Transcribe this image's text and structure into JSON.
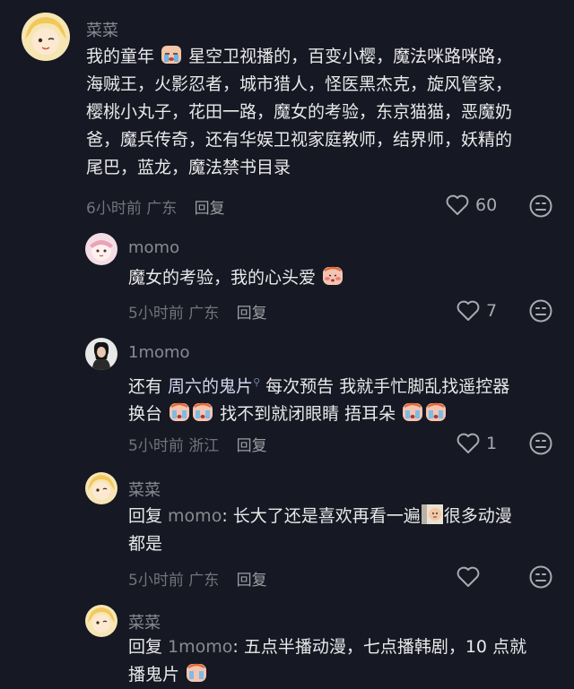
{
  "comments": [
    {
      "username": "菜菜",
      "lines": [
        [
          "我的童年",
          "",
          "星空卫视播的，百变小樱，魔法咪路咪路，"
        ],
        [
          "海贼王，火影忍者，城市猎人，怪医黑杰克，旋风管家，"
        ],
        [
          "樱桃小丸子，花田一路，魔女的考验，东京猫猫，恶魔奶"
        ],
        [
          "爸，魔兵传奇，还有华娱卫视家庭教师，结界师，妖精的"
        ],
        [
          "尾巴，蓝龙，魔法禁书目录"
        ]
      ],
      "time": "6小时前",
      "location": "广东",
      "reply": "回复",
      "likes": "60"
    },
    {
      "username": "momo",
      "lines": [
        [
          "魔女的考验，我的心头爱"
        ]
      ],
      "time": "5小时前",
      "location": "广东",
      "reply": "回复",
      "likes": "7"
    },
    {
      "username": "1momo",
      "line1_prefix": "还有 ",
      "line1_link": "周六的鬼片",
      "line1_suffix": "  每次预告 我就手忙脚乱找遥控器",
      "line2_a": "换台",
      "line2_b": "  找不到就闭眼睛 捂耳朵",
      "time": "5小时前",
      "location": "浙江",
      "reply": "回复",
      "likes": "1"
    },
    {
      "username": "菜菜",
      "reply_prefix": "回复 ",
      "reply_to": "momo",
      "line1": ": 长大了还是喜欢再看一遍",
      "line1_end": "很多动漫",
      "line2": "都是",
      "time": "5小时前",
      "location": "广东",
      "reply": "回复"
    },
    {
      "username": "菜菜",
      "reply_prefix": "回复 ",
      "reply_to": "1momo",
      "line1": ": 五点半播动漫，七点播韩剧，10 点就",
      "line2": "播鬼片"
    }
  ]
}
